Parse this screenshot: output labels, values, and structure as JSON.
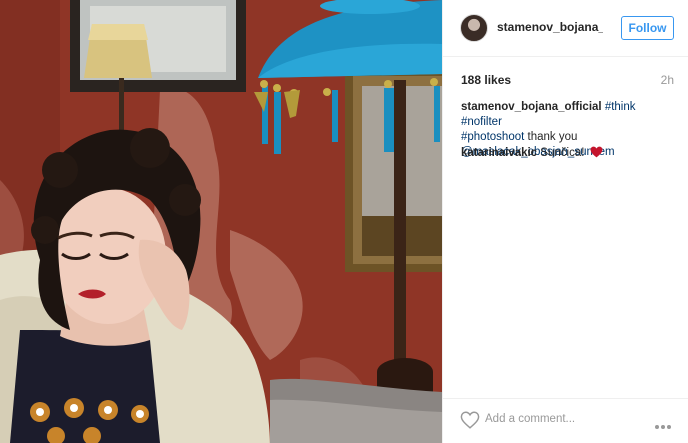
{
  "post": {
    "username": "stamenov_bojana_...",
    "follow_label": "Follow",
    "likes": "188 likes",
    "time": "2h"
  },
  "caption": {
    "user": "stamenov_bojana_official",
    "tag_think": "#think",
    "tag_nofilter": "#nofilter",
    "tag_photoshoot": "#photoshoot",
    "text": "thank you",
    "mention": "@maslacak_obasjan_suncem"
  },
  "comments": [
    {
      "user": "katarinaivakic",
      "text": "Sunčica!"
    }
  ],
  "comment_box": {
    "placeholder": "Add a comment..."
  },
  "icons": {
    "heart_comment": "heart-icon",
    "like": "heart-outline-icon",
    "more": "more-options-icon",
    "avatar": "avatar"
  },
  "colors": {
    "link": "#003569",
    "follow": "#3897f0",
    "heart": "#ed4956",
    "muted": "#999999"
  }
}
